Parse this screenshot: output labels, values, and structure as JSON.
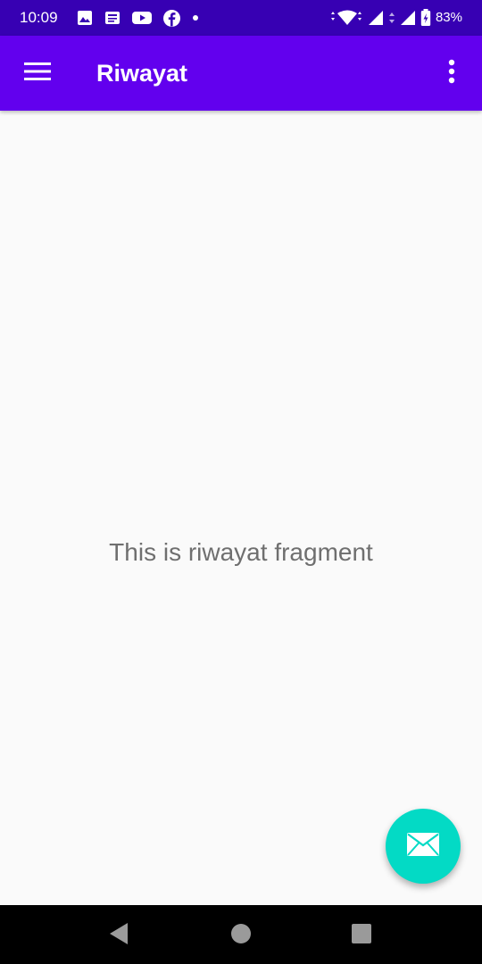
{
  "status_bar": {
    "time": "10:09",
    "battery_percent": "83%",
    "background": "#3700b3",
    "left_icons": [
      "gallery-icon",
      "news-icon",
      "youtube-icon",
      "facebook-icon",
      "dot-icon"
    ],
    "right_icons": [
      "wifi-icon",
      "signal-icon",
      "signal-icon",
      "battery-icon"
    ]
  },
  "app_bar": {
    "title": "Riwayat",
    "background": "#6200ee",
    "menu_icon": "hamburger-menu-icon",
    "overflow_icon": "more-vert-icon"
  },
  "main": {
    "message": "This is riwayat fragment"
  },
  "fab": {
    "icon": "email-icon",
    "color": "#03dac5"
  },
  "navigation_bar": {
    "buttons": [
      "back-icon",
      "home-icon",
      "recents-icon"
    ]
  }
}
